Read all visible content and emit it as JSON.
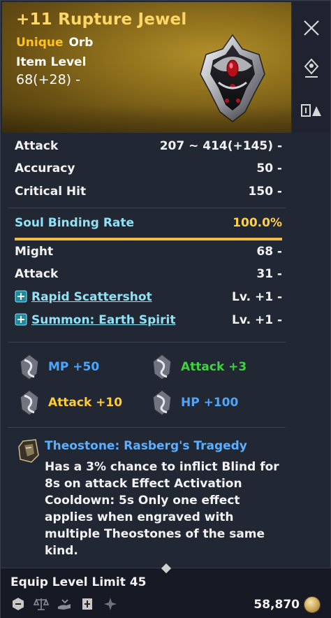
{
  "header": {
    "item_name": "+11 Rupture Jewel",
    "grade": "Unique",
    "item_type": "Orb",
    "item_level_label": "Item Level",
    "item_level_value": "68(+28) -"
  },
  "stats": [
    {
      "label": "Attack",
      "value": "207 ~ 414(+145) -"
    },
    {
      "label": "Accuracy",
      "value": "50 -"
    },
    {
      "label": "Critical Hit",
      "value": "150 -"
    }
  ],
  "soul_binding": {
    "label": "Soul Binding Rate",
    "value": "100.0%",
    "fill_percent": 100
  },
  "bonus_stats": [
    {
      "label": "Might",
      "value": "68 -"
    },
    {
      "label": "Attack",
      "value": "31 -"
    }
  ],
  "skills": [
    {
      "name": "Rapid Scattershot",
      "value": "Lv. +1 -"
    },
    {
      "name": "Summon: Earth Spirit",
      "value": "Lv. +1 -"
    }
  ],
  "engravings": [
    {
      "text": "MP +50",
      "color": "#4aa6ff"
    },
    {
      "text": "Attack +3",
      "color": "#3fd23f"
    },
    {
      "text": "Attack +10",
      "color": "#ffcc33"
    },
    {
      "text": "HP +100",
      "color": "#4aa6ff"
    }
  ],
  "theostone": {
    "title": "Theostone: Rasberg's Tragedy",
    "description": "Has a 3% chance to inflict Blind for 8s on attack Effect Activation Cooldown: 5s Only one effect applies when engraved with multiple Theostones of the same kind."
  },
  "footer": {
    "equip_level_limit": "Equip Level Limit 45",
    "price": "58,870",
    "icons": [
      "hexagon-icon",
      "scale-icon",
      "hand-icon",
      "book-icon",
      "star-icon"
    ]
  },
  "sidebar": {
    "icons": [
      "close-icon",
      "pin-icon",
      "compare-icon"
    ]
  }
}
